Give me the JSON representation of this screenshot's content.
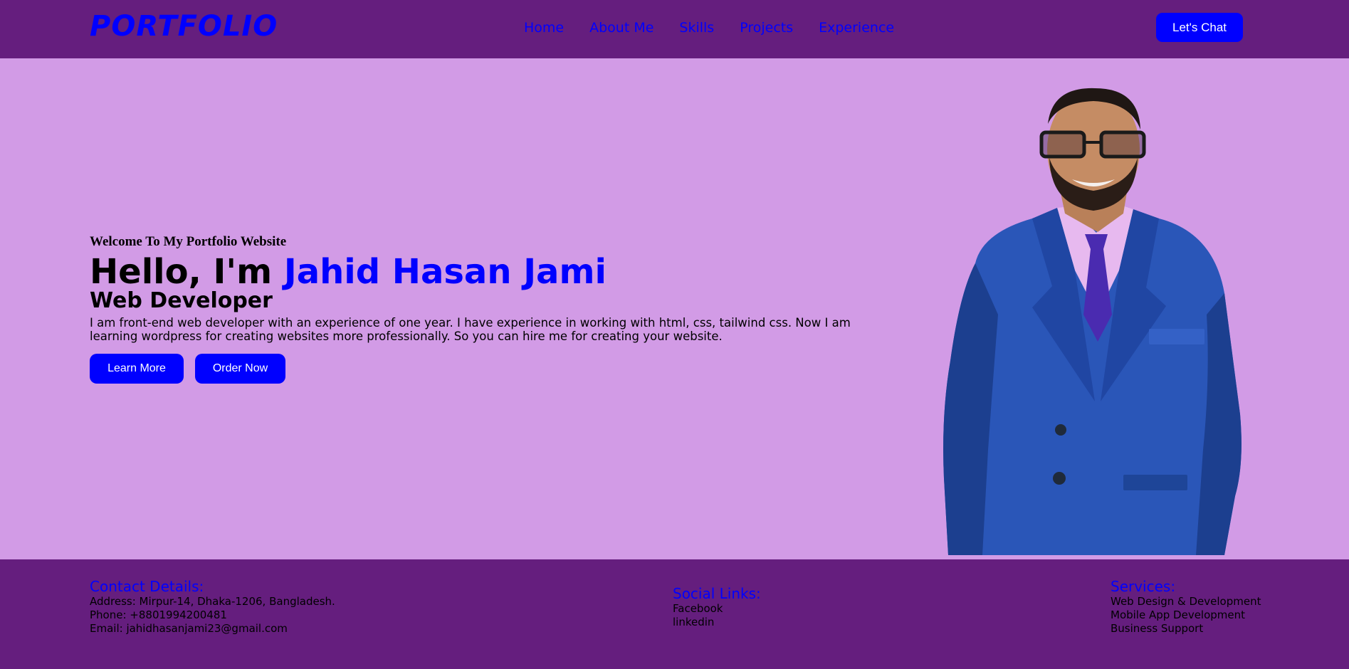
{
  "nav": {
    "logo": "PORTFOLIO",
    "links": [
      "Home",
      "About Me",
      "Skills",
      "Projects",
      "Experience"
    ],
    "cta": "Let's Chat"
  },
  "hero": {
    "welcome": "Welcome To My Portfolio Website",
    "hello_prefix": "Hello, I'm ",
    "name": "Jahid Hasan Jami",
    "role": "Web Developer",
    "bio": "I am front-end web developer with an experience of one year. I have experience in working with html, css, tailwind css. Now I am learning wordpress for creating websites more professionally. So you can hire me for creating your website.",
    "learn_more": "Learn More",
    "order_now": "Order Now"
  },
  "footer": {
    "contact": {
      "title": "Contact Details:",
      "address": "Address: Mirpur-14, Dhaka-1206, Bangladesh.",
      "phone": "Phone: +8801994200481",
      "email": "Email: jahidhasanjami23@gmail.com"
    },
    "social": {
      "title": "Social Links:",
      "links": [
        "Facebook",
        "linkedin"
      ]
    },
    "services": {
      "title": "Services:",
      "items": [
        "Web Design & Development",
        "Mobile App Development",
        "Business Support"
      ]
    }
  },
  "colors": {
    "nav_bg": "#651e7e",
    "hero_bg": "#d29be6",
    "accent": "#0000ff"
  }
}
